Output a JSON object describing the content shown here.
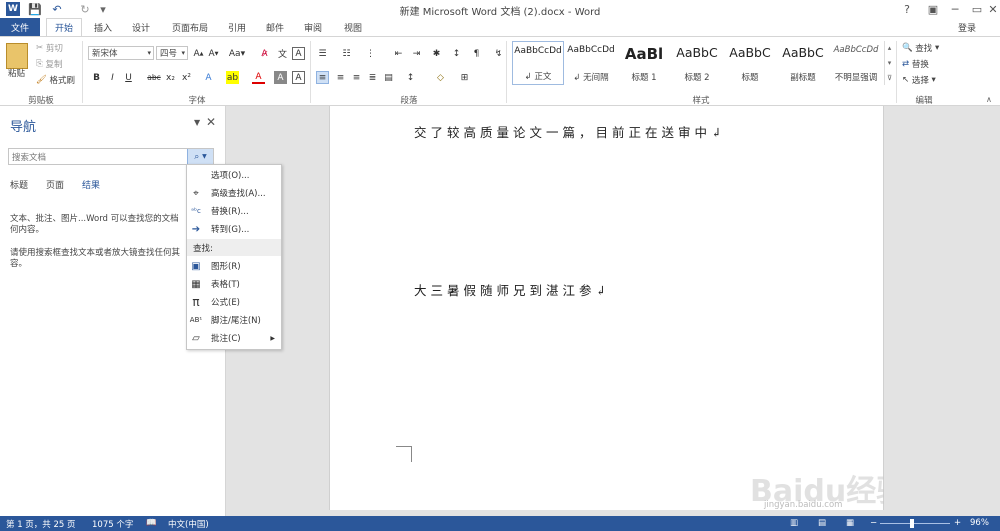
{
  "window": {
    "title": "新建 Microsoft Word 文档 (2).docx - Word",
    "help": "?",
    "minimize": "─",
    "restore": "▭",
    "close": "✕"
  },
  "quick_access": [
    "W",
    "💾",
    "↶",
    "↻",
    "▾"
  ],
  "tabs": [
    "文件",
    "开始",
    "插入",
    "设计",
    "页面布局",
    "引用",
    "邮件",
    "审阅",
    "视图"
  ],
  "account": "登录",
  "ribbon": {
    "clipboard": {
      "paste": "粘贴",
      "cut": "剪切",
      "copy": "复制",
      "format_painter": "格式刷",
      "label": "剪贴板"
    },
    "font": {
      "family": "新宋体",
      "size": "四号",
      "label": "字体",
      "buttons": [
        "B",
        "I",
        "U",
        "abc",
        "x₂",
        "x²"
      ]
    },
    "paragraph": {
      "label": "段落"
    },
    "styles": {
      "label": "样式",
      "items": [
        {
          "preview": "AaBbCcDd",
          "name": "↲ 正文"
        },
        {
          "preview": "AaBbCcDd",
          "name": "↲ 无间隔"
        },
        {
          "preview": "AaBl",
          "name": "标题 1"
        },
        {
          "preview": "AaBbC",
          "name": "标题 2"
        },
        {
          "preview": "AaBbC",
          "name": "标题"
        },
        {
          "preview": "AaBbC",
          "name": "副标题"
        },
        {
          "preview": "AaBbCcDd",
          "name": "不明显强调"
        }
      ]
    },
    "editing": {
      "find": "查找",
      "replace": "替换",
      "select": "选择",
      "label": "编辑"
    }
  },
  "nav": {
    "title": "导航",
    "search_placeholder": "搜索文档",
    "tabs": [
      "标题",
      "页面",
      "结果"
    ],
    "info1a": "文本、批注、图片...Word 可以查找您的文档",
    "info1b": "何内容。",
    "info2a": "请使用搜索框查找文本或者放大镜查找任何其",
    "info2b": "容。"
  },
  "search_menu": {
    "items": [
      {
        "label": "选项(O)...",
        "icon": ""
      },
      {
        "label": "高级查找(A)...",
        "icon": "binoculars"
      },
      {
        "label": "替换(R)...",
        "icon": "replace"
      },
      {
        "label": "转到(G)...",
        "icon": "arrow-right"
      }
    ],
    "find_header": "查找:",
    "find_items": [
      {
        "label": "图形(R)",
        "icon": "graphic"
      },
      {
        "label": "表格(T)",
        "icon": "table"
      },
      {
        "label": "公式(E)",
        "icon": "pi"
      },
      {
        "label": "脚注/尾注(N)",
        "icon": "footnote"
      },
      {
        "label": "批注(C)",
        "icon": "comment"
      }
    ]
  },
  "document": {
    "line1": "交了较高质量论文一篇，目前正在送审中↲",
    "line2": "大三暑假随师兄到湛江参↲"
  },
  "watermark": {
    "brand": "Baidu经验",
    "url": "jingyan.baidu.com"
  },
  "status": {
    "page": "第 1 页，共 25 页",
    "words": "1075 个字",
    "language": "中文(中国)",
    "zoom": "96%",
    "zoom_level": 0.96
  }
}
